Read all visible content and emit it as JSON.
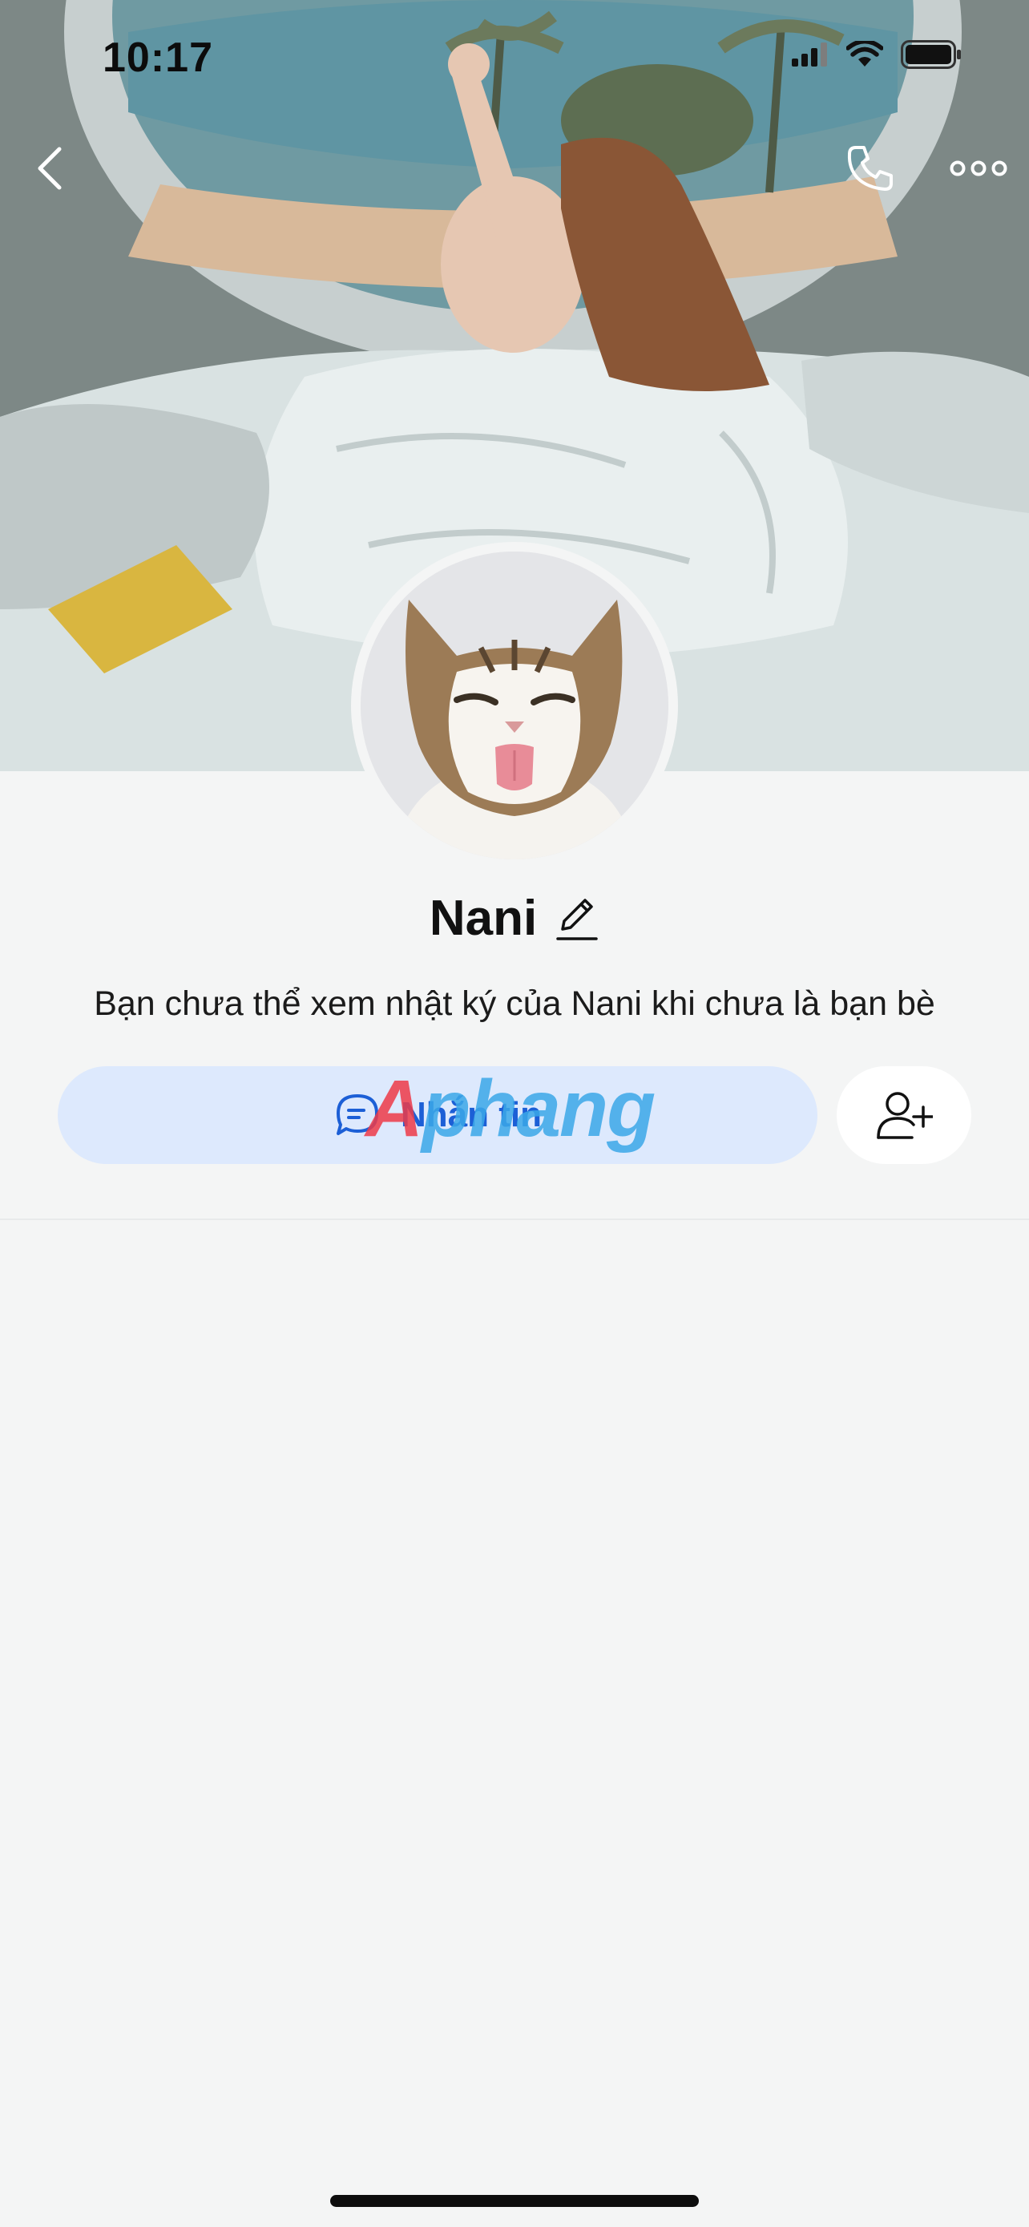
{
  "status_bar": {
    "time": "10:17"
  },
  "nav": {
    "back_icon": "chevron-left-icon",
    "call_icon": "phone-icon",
    "more_icon": "more-dots-icon"
  },
  "profile": {
    "name": "Nani",
    "diary_note": "Bạn chưa thể xem nhật ký của Nani khi chưa là bạn bè"
  },
  "actions": {
    "message_label": "Nhắn tin",
    "message_icon": "chat-bubble-icon",
    "add_friend_icon": "add-friend-icon"
  },
  "watermark": {
    "first": "A",
    "rest": "phang"
  },
  "colors": {
    "background": "#f4f5f5",
    "message_button_bg": "#dde9fd",
    "message_text": "#1c5fd6"
  }
}
